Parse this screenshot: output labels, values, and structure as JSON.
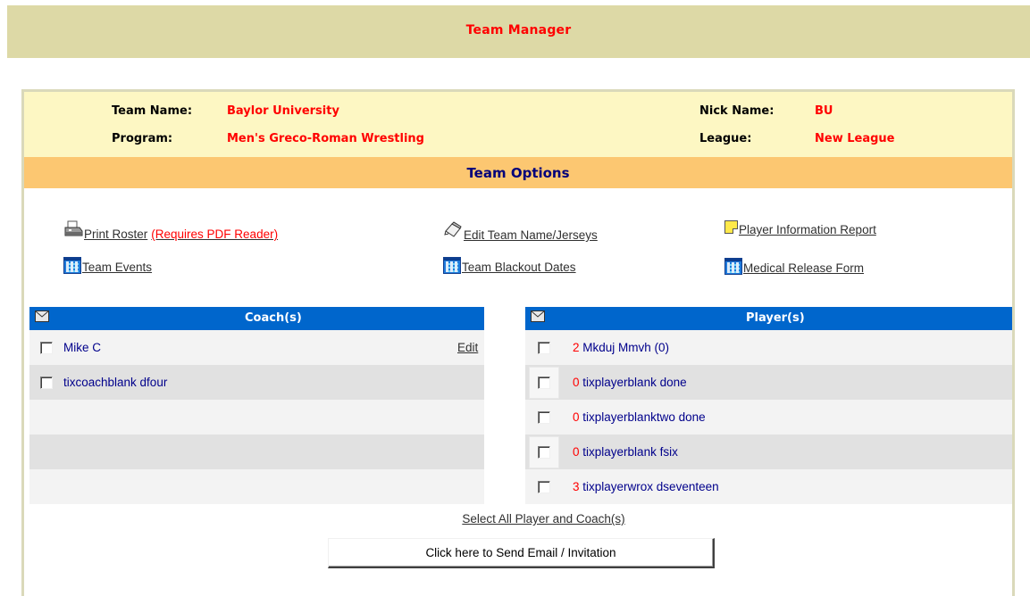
{
  "page": {
    "title": "Team Manager"
  },
  "team_info": {
    "team_name_label": "Team Name:",
    "team_name": "Baylor University",
    "nick_name_label": "Nick Name:",
    "nick_name": "BU",
    "program_label": "Program:",
    "program": "Men's Greco-Roman Wrestling",
    "league_label": "League:",
    "league": "New League"
  },
  "options": {
    "title": "Team Options",
    "print_roster": "Print Roster",
    "requires_pdf": "(Requires PDF Reader)",
    "edit_team": "Edit Team Name/Jerseys",
    "player_info_report": "Player Information Report",
    "team_events": "Team Events",
    "team_blackout": "Team Blackout Dates",
    "medical_release": "Medical Release Form"
  },
  "coaches": {
    "header": "Coach(s)",
    "edit_label": "Edit",
    "items": [
      {
        "name": "Mike C"
      },
      {
        "name": "tixcoachblank dfour"
      }
    ]
  },
  "players": {
    "header": "Player(s)",
    "items": [
      {
        "number": "2",
        "name": "Mkduj Mmvh (0)"
      },
      {
        "number": "0",
        "name": "tixplayerblank done"
      },
      {
        "number": "0",
        "name": "tixplayerblanktwo done"
      },
      {
        "number": "0",
        "name": "tixplayerblank fsix"
      },
      {
        "number": "3",
        "name": "tixplayerwrox dseventeen"
      }
    ]
  },
  "actions": {
    "select_all": "Select All Player and Coach(s)",
    "send_email": "Click here to Send Email / Invitation"
  },
  "icons": {
    "print": "printer-icon",
    "edit": "pencil-icon",
    "note": "note-icon",
    "calendar": "calendar-grid-icon",
    "mail": "envelope-icon"
  },
  "colors": {
    "topbar": "#ddd9a6",
    "info_bg": "#fdf7c3",
    "options_bar": "#fcc771",
    "list_header": "#0066cc",
    "accent_red": "#ff0000"
  }
}
